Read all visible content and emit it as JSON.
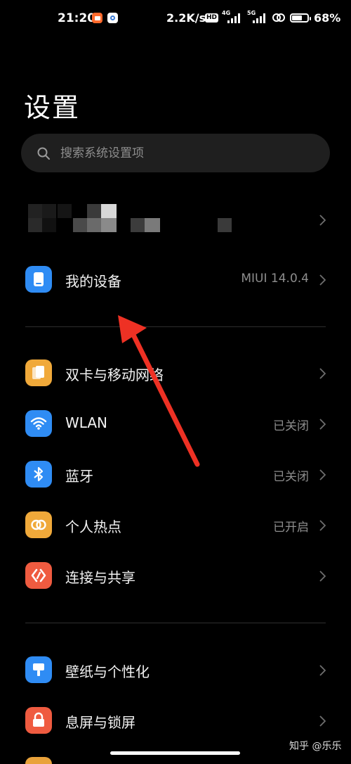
{
  "status_bar": {
    "time": "21:20",
    "network_speed": "2.2K/s",
    "hd_badge": "HD",
    "net_type_1": "4G",
    "net_type_2": "5G",
    "battery_percent": "68%",
    "battery_level": 0.68
  },
  "page": {
    "title": "设置"
  },
  "search": {
    "placeholder": "搜索系统设置项"
  },
  "items": [
    {
      "id": "my-device",
      "label": "我的设备",
      "value": "MIUI 14.0.4",
      "icon": "phone-icon",
      "color": "#2f8cf4"
    },
    {
      "id": "sim-network",
      "label": "双卡与移动网络",
      "value": "",
      "icon": "sim-card-icon",
      "color": "#f0a93a"
    },
    {
      "id": "wlan",
      "label": "WLAN",
      "value": "已关闭",
      "icon": "wifi-icon",
      "color": "#2f8cf4"
    },
    {
      "id": "bluetooth",
      "label": "蓝牙",
      "value": "已关闭",
      "icon": "bluetooth-icon",
      "color": "#2f8cf4"
    },
    {
      "id": "hotspot",
      "label": "个人热点",
      "value": "已开启",
      "icon": "hotspot-icon",
      "color": "#f0a93a"
    },
    {
      "id": "connection-sharing",
      "label": "连接与共享",
      "value": "",
      "icon": "share-icon",
      "color": "#ef5b40"
    },
    {
      "id": "wallpaper",
      "label": "壁纸与个性化",
      "value": "",
      "icon": "wallpaper-icon",
      "color": "#2f8cf4"
    },
    {
      "id": "lock-screen",
      "label": "息屏与锁屏",
      "value": "",
      "icon": "lock-icon",
      "color": "#ef5b40"
    }
  ],
  "annotation": {
    "arrow_color": "#ee3124"
  },
  "watermark": {
    "text": "知乎 @乐乐"
  }
}
